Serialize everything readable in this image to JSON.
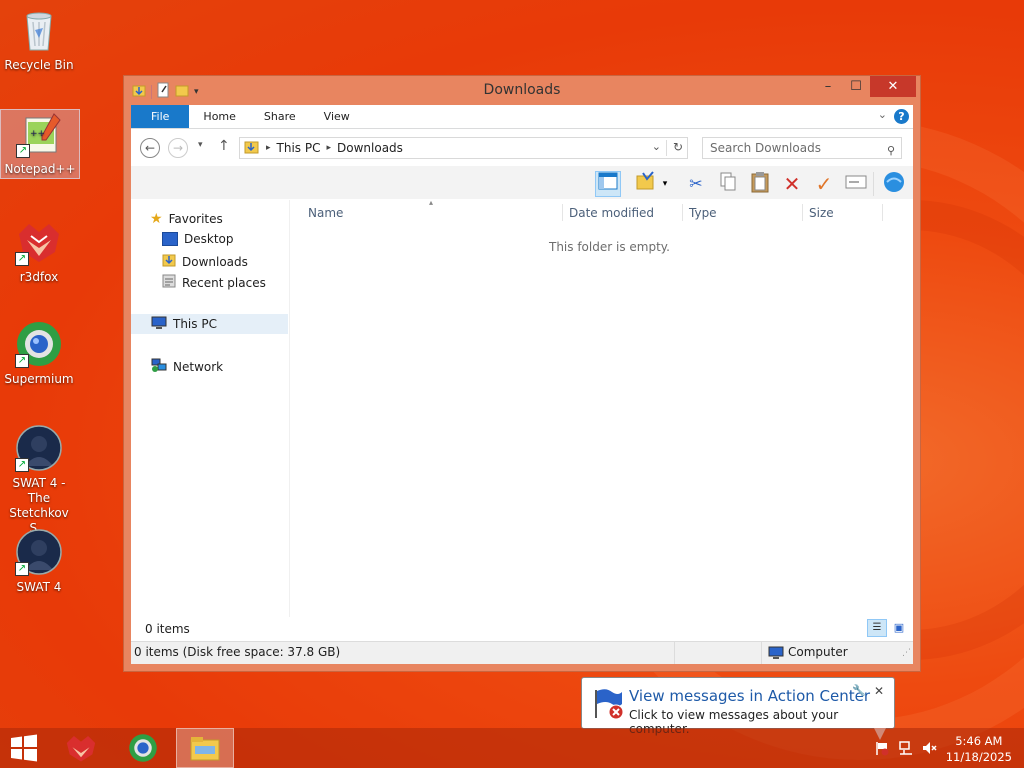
{
  "desktop": {
    "icons": [
      {
        "label": "Recycle Bin",
        "icon": "recycle-bin-icon"
      },
      {
        "label": "Notepad++",
        "icon": "notepad-plus-plus-icon"
      },
      {
        "label": "r3dfox",
        "icon": "r3dfox-icon"
      },
      {
        "label": "Supermium",
        "icon": "supermium-icon"
      },
      {
        "label": "SWAT 4 - The Stetchkov S...",
        "icon": "swat4-stetchkov-icon"
      },
      {
        "label": "SWAT 4",
        "icon": "swat4-icon"
      }
    ]
  },
  "window": {
    "title": "Downloads",
    "controls": {
      "minimize": "–",
      "maximize": "☐",
      "close": "✕"
    },
    "ribbon_tabs": [
      "File",
      "Home",
      "Share",
      "View"
    ],
    "help": "?",
    "address": {
      "segments": [
        "This PC",
        "Downloads"
      ]
    },
    "search_placeholder": "Search Downloads",
    "nav_pane": {
      "favorites": "Favorites",
      "favorite_items": [
        "Desktop",
        "Downloads",
        "Recent places"
      ],
      "this_pc": "This PC",
      "network": "Network"
    },
    "columns": [
      "Name",
      "Date modified",
      "Type",
      "Size"
    ],
    "empty_message": "This folder is empty.",
    "item_count": "0 items",
    "status_left": "0 items (Disk free space: 37.8 GB)",
    "status_right": "Computer"
  },
  "notification": {
    "title": "View messages in Action Center",
    "text": "Click to view messages about your computer."
  },
  "taskbar": {
    "items": [
      "start-button",
      "r3dfox",
      "supermium",
      "file-explorer"
    ],
    "clock": {
      "time": "5:46 AM",
      "date": "11/18/2025"
    }
  }
}
